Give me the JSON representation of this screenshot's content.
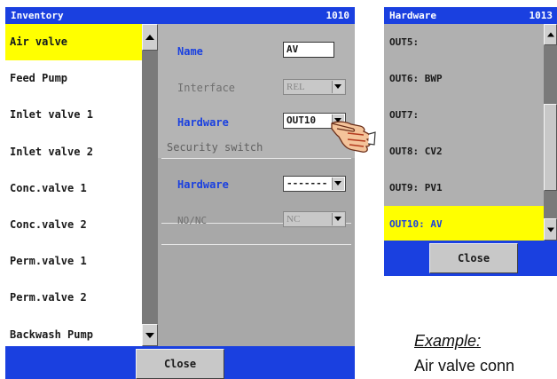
{
  "inventory": {
    "title": "Inventory",
    "id_number": "1010",
    "items": [
      {
        "label": "Air valve"
      },
      {
        "label": "Feed Pump"
      },
      {
        "label": "Inlet valve 1"
      },
      {
        "label": "Inlet valve 2"
      },
      {
        "label": "Conc.valve 1"
      },
      {
        "label": "Conc.valve 2"
      },
      {
        "label": "Perm.valve 1"
      },
      {
        "label": "Perm.valve 2"
      },
      {
        "label": "Backwash Pump"
      }
    ],
    "properties": {
      "name_label": "Name",
      "name_value": "AV",
      "interface_label": "Interface",
      "interface_value": "REL",
      "hardware_label": "Hardware",
      "hardware_value": "OUT10",
      "security_section": "Security switch",
      "security_hardware_label": "Hardware",
      "security_hardware_value": "-------",
      "nonc_label": "NO/NC",
      "nonc_value": "NC"
    },
    "close_label": "Close"
  },
  "hardware": {
    "title": "Hardware",
    "id_number": "1013",
    "items": [
      {
        "label": "OUT5:"
      },
      {
        "label": "OUT6: BWP"
      },
      {
        "label": "OUT7:"
      },
      {
        "label": "OUT8: CV2"
      },
      {
        "label": "OUT9: PV1"
      },
      {
        "label": "OUT10: AV"
      }
    ],
    "close_label": "Close"
  },
  "caption": {
    "title": "Example:",
    "text": "Air valve conn"
  },
  "icons": [
    "scroll-up-icon",
    "scroll-down-icon",
    "dropdown-arrow-icon",
    "pointing-hand-icon"
  ],
  "colors": {
    "title_bar": "#1a40e0",
    "selection": "#ffff00",
    "panel_gray": "#b4b4b4"
  }
}
